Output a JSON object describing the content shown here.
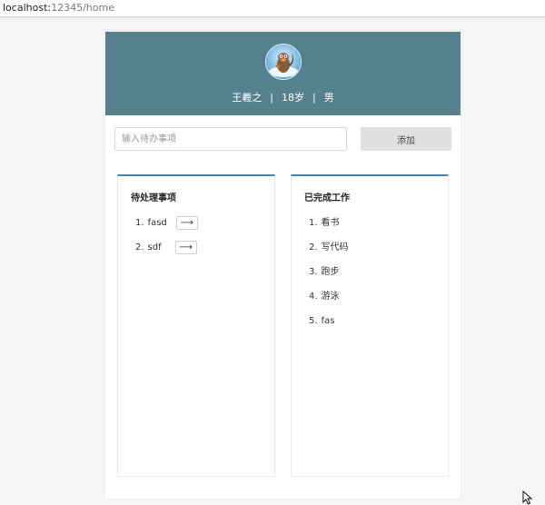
{
  "browser": {
    "url_host": "localhost:",
    "url_rest": "12345/home"
  },
  "colors": {
    "header_bg": "#55818f",
    "panel_accent": "#4a7fae",
    "add_button_bg": "#e0e0e0"
  },
  "profile": {
    "name": "王羲之",
    "age": "18岁",
    "gender": "男",
    "separator": "|",
    "avatar_icon": "squirrel-avatar-icon"
  },
  "todo_input": {
    "placeholder": "输入待办事项",
    "value": ""
  },
  "add_button": {
    "label": "添加"
  },
  "pending": {
    "title": "待处理事项",
    "move_icon": "arrow-right-icon",
    "move_glyph": "⟶",
    "items": [
      {
        "num": "1.",
        "text": "fasd"
      },
      {
        "num": "2.",
        "text": "sdf"
      }
    ]
  },
  "done": {
    "title": "已完成工作",
    "items": [
      {
        "num": "1.",
        "text": "看书"
      },
      {
        "num": "2.",
        "text": "写代码"
      },
      {
        "num": "3.",
        "text": "跑步"
      },
      {
        "num": "4.",
        "text": "游泳"
      },
      {
        "num": "5.",
        "text": "fas"
      }
    ]
  }
}
